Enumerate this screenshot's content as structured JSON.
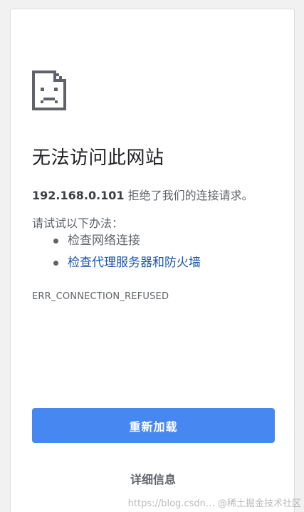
{
  "error_page": {
    "icon": "sad-document-icon",
    "title": "无法访问此网站",
    "host": "192.168.0.101",
    "message_suffix": " 拒绝了我们的连接请求。",
    "suggestions_header": "请试试以下办法：",
    "suggestions": [
      {
        "label": "检查网络连接",
        "is_link": false
      },
      {
        "label": "检查代理服务器和防火墙",
        "is_link": true
      }
    ],
    "error_code": "ERR_CONNECTION_REFUSED",
    "reload_label": "重新加载",
    "details_label": "详细信息"
  },
  "watermark": "https://blog.csdn… @稀土掘金技术社区",
  "colors": {
    "primary_button": "#4787f2",
    "link": "#1a55b8",
    "text_secondary": "#5f6368",
    "title": "#202124"
  }
}
